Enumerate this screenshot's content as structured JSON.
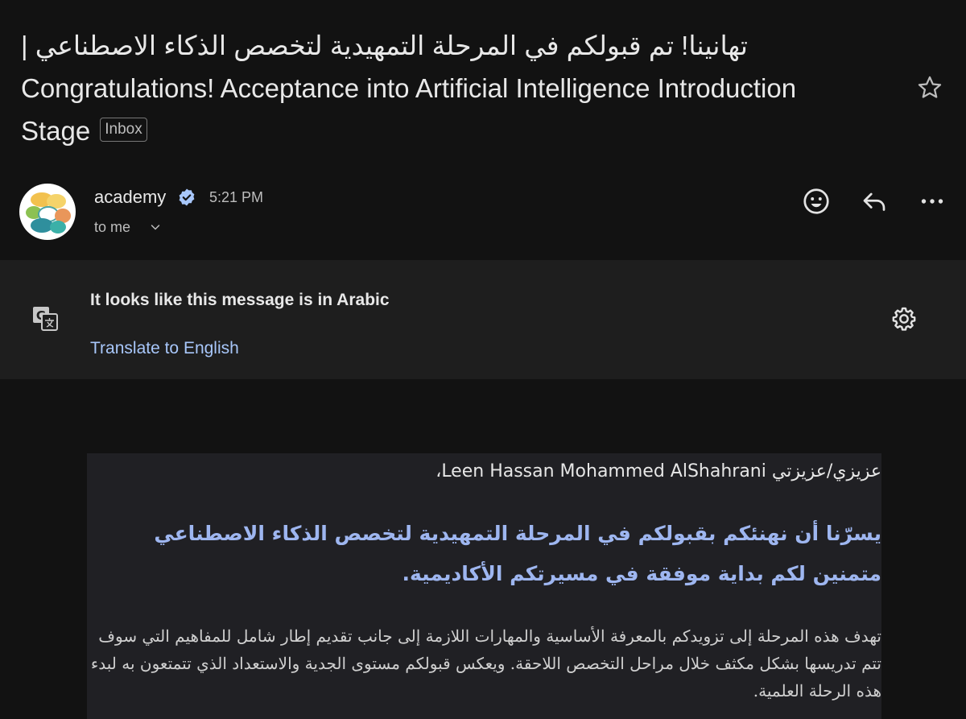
{
  "email": {
    "subject_line_ar": "تهانينا! تم قبولكم في المرحلة التمهيدية لتخصص الذكاء الاصطناعي |",
    "subject_line_en": "Congratulations! Acceptance into Artificial Intelligence Introduction Stage",
    "label_badge": "Inbox",
    "sender_name": "academy",
    "time": "5:21 PM",
    "recipient": "to me"
  },
  "translate_bar": {
    "title": "It looks like this message is in Arabic",
    "link": "Translate to English"
  },
  "body": {
    "greeting": "عزيزي/عزيزتي Leen Hassan Mohammed AlShahrani،",
    "highlight": "يسرّنا أن نهنئكم بقبولكم في المرحلة التمهيدية لتخصص الذكاء الاصطناعي متمنين لكم بداية موفقة في مسيرتكم الأكاديمية.",
    "paragraph": "تهدف هذه المرحلة إلى تزويدكم بالمعرفة الأساسية والمهارات اللازمة إلى جانب تقديم إطار شامل للمفاهيم التي سوف تتم تدريسها بشكل مكثف خلال مراحل التخصص اللاحقة. ويعكس قبولكم مستوى الجدية والاستعداد الذي تتمتعون به لبدء هذه الرحلة العلمية."
  },
  "icons": {
    "star": "star-icon",
    "verified": "verified-badge-icon",
    "emoji": "emoji-reaction-icon",
    "reply": "reply-icon",
    "more": "more-options-icon",
    "translate": "translate-icon",
    "settings": "gear-icon",
    "expand": "chevron-down-icon"
  },
  "colors": {
    "background": "#121212",
    "translate_bar": "#1e1e1e",
    "link": "#a8c7fa",
    "verified": "#a8c7fa",
    "highlight_text": "#9eb6f0",
    "card": "#202024"
  }
}
